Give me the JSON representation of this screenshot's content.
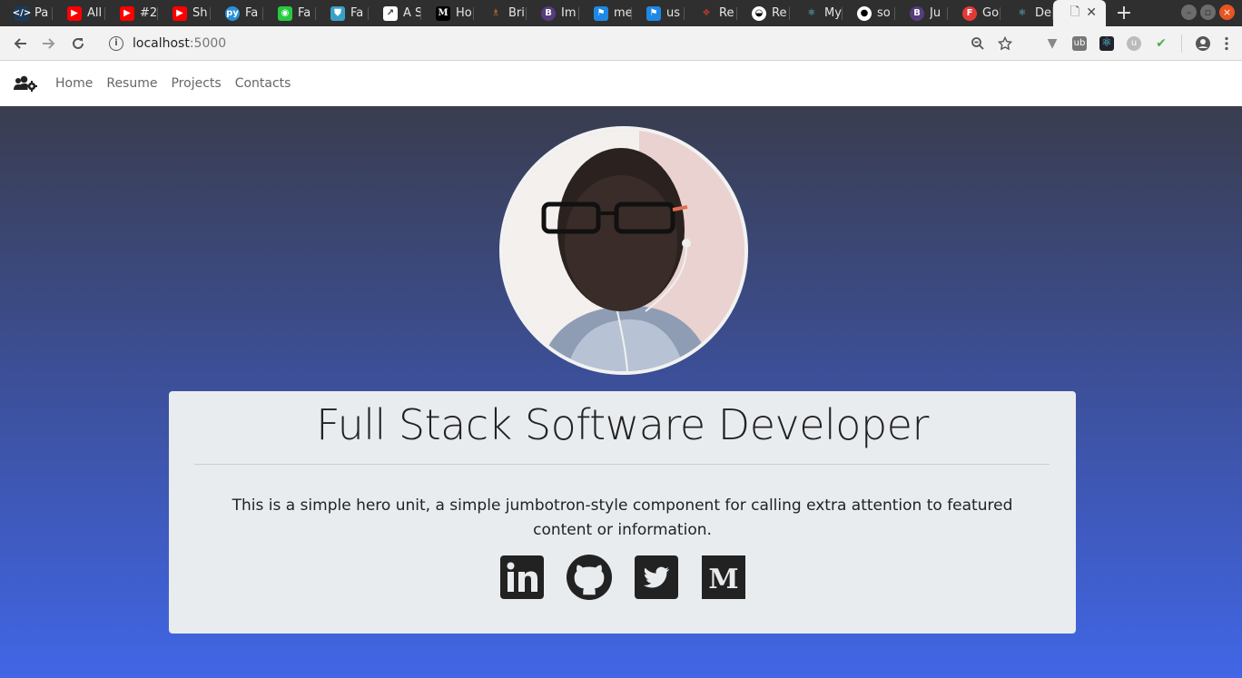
{
  "browser": {
    "tabs": [
      {
        "title": "Pa",
        "icon": "code-icon",
        "color": "#1b3a57"
      },
      {
        "title": "All",
        "icon": "youtube-icon",
        "color": "#ff0000"
      },
      {
        "title": "#2",
        "icon": "youtube-icon",
        "color": "#ff0000"
      },
      {
        "title": "Sh",
        "icon": "youtube-icon",
        "color": "#ff0000"
      },
      {
        "title": "Fa",
        "icon": "python-icon",
        "color": "#2b8fd6"
      },
      {
        "title": "Fa",
        "icon": "frontend-icon",
        "color": "#27c93f"
      },
      {
        "title": "Fa",
        "icon": "shield-icon",
        "color": "#3aa0c8"
      },
      {
        "title": "A S",
        "icon": "chart-icon",
        "color": "#ffffff"
      },
      {
        "title": "Ho",
        "icon": "medium-icon",
        "color": "#000000"
      },
      {
        "title": "Bri",
        "icon": "mortarboard-icon",
        "color": "#e67e22"
      },
      {
        "title": "Im",
        "icon": "bootstrap-icon",
        "color": "#563d7c"
      },
      {
        "title": "me",
        "icon": "flag-icon",
        "color": "#1e88e5"
      },
      {
        "title": "us",
        "icon": "flag-icon",
        "color": "#1e88e5"
      },
      {
        "title": "Re",
        "icon": "redux-icon",
        "color": "#c0392b"
      },
      {
        "title": "Re",
        "icon": "turtle-icon",
        "color": "#ffffff"
      },
      {
        "title": "My",
        "icon": "react-icon",
        "color": "#61dafb"
      },
      {
        "title": "so",
        "icon": "github-icon",
        "color": "#ffffff"
      },
      {
        "title": "Ju",
        "icon": "bootstrap-icon",
        "color": "#563d7c"
      },
      {
        "title": "Go",
        "icon": "f-icon",
        "color": "#e53935"
      },
      {
        "title": "De",
        "icon": "react-icon",
        "color": "#61dafb"
      }
    ],
    "active_tab_icon": "page-icon",
    "url_host": "localhost",
    "url_port": ":5000"
  },
  "nav": {
    "brand_icon": "users-cog-icon",
    "links": [
      "Home",
      "Resume",
      "Projects",
      "Contacts"
    ]
  },
  "hero": {
    "title": "Full Stack Software Developer",
    "lead": "This is a simple hero unit, a simple jumbotron-style component for calling extra attention to featured content or information.",
    "socials": [
      {
        "name": "linkedin-icon"
      },
      {
        "name": "github-icon"
      },
      {
        "name": "twitter-icon"
      },
      {
        "name": "medium-icon"
      }
    ]
  }
}
